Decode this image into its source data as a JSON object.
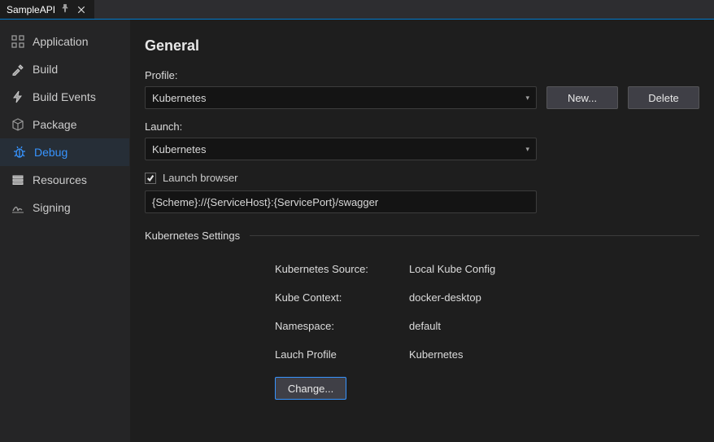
{
  "tab": {
    "title": "SampleAPI"
  },
  "sidebar": {
    "items": [
      {
        "id": "application",
        "label": "Application"
      },
      {
        "id": "build",
        "label": "Build"
      },
      {
        "id": "build-events",
        "label": "Build Events"
      },
      {
        "id": "package",
        "label": "Package"
      },
      {
        "id": "debug",
        "label": "Debug"
      },
      {
        "id": "resources",
        "label": "Resources"
      },
      {
        "id": "signing",
        "label": "Signing"
      }
    ],
    "active": "debug"
  },
  "main": {
    "heading": "General",
    "profile_label": "Profile:",
    "profile_value": "Kubernetes",
    "btn_new": "New...",
    "btn_delete": "Delete",
    "launch_label": "Launch:",
    "launch_value": "Kubernetes",
    "launch_browser_label": "Launch browser",
    "launch_browser_checked": true,
    "launch_url": "{Scheme}://{ServiceHost}:{ServicePort}/swagger",
    "k8s_section_title": "Kubernetes Settings",
    "k8s": [
      {
        "k": "Kubernetes Source:",
        "v": "Local Kube Config"
      },
      {
        "k": "Kube Context:",
        "v": "docker-desktop"
      },
      {
        "k": "Namespace:",
        "v": "default"
      },
      {
        "k": "Lauch Profile",
        "v": "Kubernetes"
      }
    ],
    "btn_change": "Change..."
  }
}
